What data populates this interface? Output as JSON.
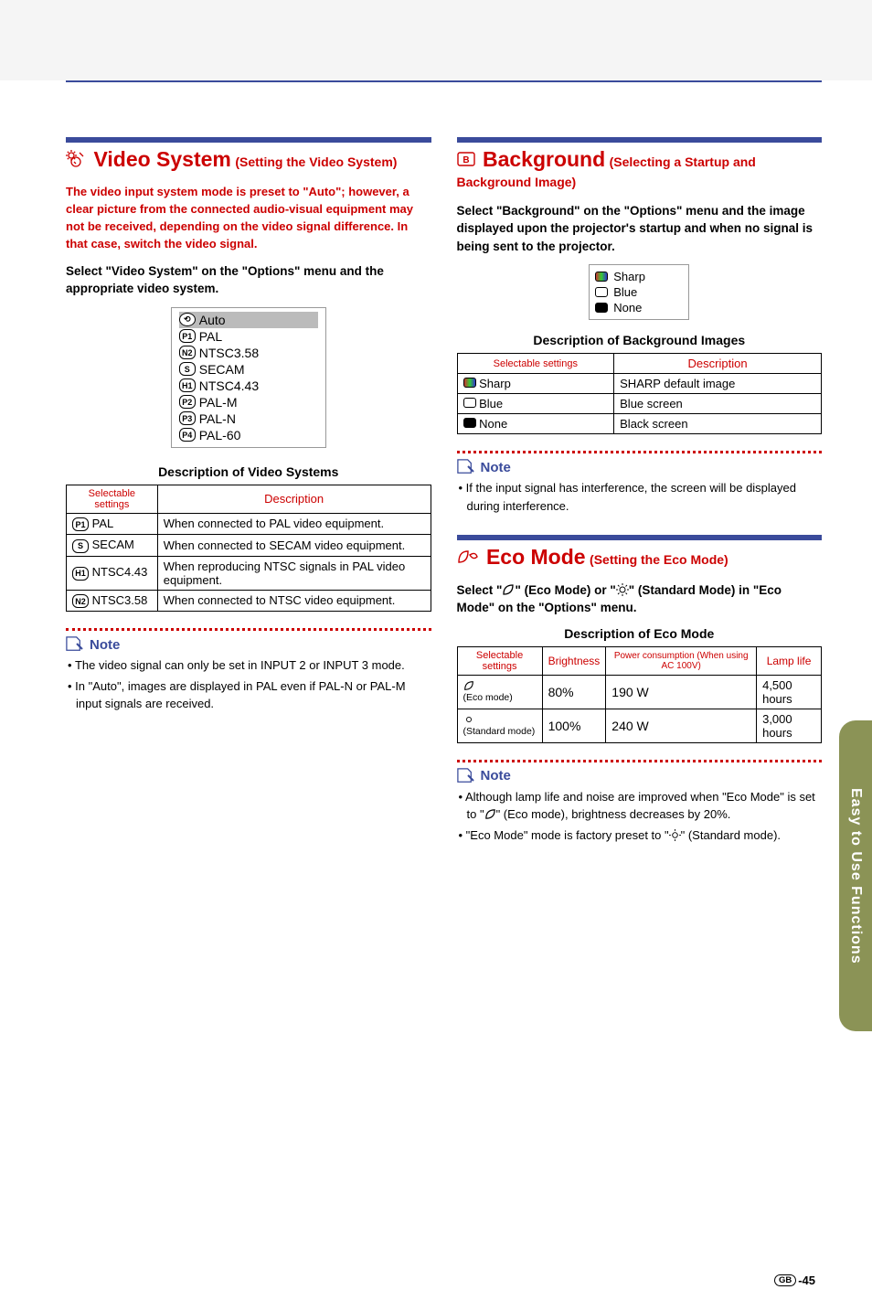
{
  "side_tab": "Easy to Use Functions",
  "left": {
    "title_main": "Video System",
    "title_sub": "(Setting the Video System)",
    "intro": "The video input system mode is preset to \"Auto\"; however, a clear picture from the connected audio-visual equipment may not be received, depending on the video signal difference. In that case, switch the video signal.",
    "instruct": "Select \"Video System\" on the \"Options\" menu and the appropriate video system.",
    "menu_items": [
      "Auto",
      "PAL",
      "NTSC3.58",
      "SECAM",
      "NTSC4.43",
      "PAL-M",
      "PAL-N",
      "PAL-60"
    ],
    "menu_badges": [
      "",
      "P1",
      "N2",
      "S",
      "H1",
      "P2",
      "P3",
      "P4"
    ],
    "desc_title": "Description of Video Systems",
    "table": {
      "head": [
        "Selectable settings",
        "Description"
      ],
      "rows": [
        {
          "b": "P1",
          "s": "PAL",
          "d": "When connected to PAL video equipment."
        },
        {
          "b": "S",
          "s": "SECAM",
          "d": "When connected to SECAM video equipment."
        },
        {
          "b": "H1",
          "s": "NTSC4.43",
          "d": "When reproducing NTSC signals in PAL video equipment."
        },
        {
          "b": "N2",
          "s": "NTSC3.58",
          "d": "When connected to NTSC video equipment."
        }
      ]
    },
    "note_label": "Note",
    "notes": [
      "The video signal can only be set in INPUT 2 or INPUT 3 mode.",
      "In \"Auto\", images are displayed in PAL even if PAL-N or PAL-M input signals are received."
    ]
  },
  "right": {
    "bg_title_main": "Background",
    "bg_title_sub": "(Selecting a Startup and Background Image)",
    "bg_instruct": "Select \"Background\" on the \"Options\" menu and the image displayed upon the projector's startup and when no signal is being sent to the projector.",
    "bg_menu": [
      "Sharp",
      "Blue",
      "None"
    ],
    "bg_desc_title": "Description of Background Images",
    "bg_table": {
      "head": [
        "Selectable settings",
        "Description"
      ],
      "rows": [
        {
          "ic": "sharp",
          "s": "Sharp",
          "d": "SHARP default image"
        },
        {
          "ic": "blue",
          "s": "Blue",
          "d": "Blue screen"
        },
        {
          "ic": "none",
          "s": "None",
          "d": "Black screen"
        }
      ]
    },
    "bg_note_label": "Note",
    "bg_notes": [
      "If the input signal has interference, the screen will be displayed during interference."
    ],
    "eco_title_main": "Eco Mode",
    "eco_title_sub": "(Setting the Eco Mode)",
    "eco_instruct_1": "Select \"",
    "eco_instruct_2": "\" (Eco Mode) or \"",
    "eco_instruct_3": "\" (Standard Mode) in \"Eco Mode\" on the \"Options\" menu.",
    "eco_desc_title": "Description of Eco Mode",
    "eco_table": {
      "head": [
        "Selectable settings",
        "Brightness",
        "Power consumption (When using AC 100V)",
        "Lamp life"
      ],
      "rows": [
        {
          "s": "(Eco mode)",
          "b": "80%",
          "p": "190 W",
          "l": "4,500 hours"
        },
        {
          "s": "(Standard mode)",
          "b": "100%",
          "p": "240 W",
          "l": "3,000 hours"
        }
      ]
    },
    "eco_note_label": "Note",
    "eco_notes_1a": "Although lamp life and noise are improved when \"Eco Mode\" is set to \"",
    "eco_notes_1b": "\" (Eco mode), brightness decreases by 20%.",
    "eco_notes_2a": "\"Eco Mode\" mode is factory preset to \"",
    "eco_notes_2b": "\" (Standard mode)."
  },
  "page_lang": "GB",
  "page_num": "-45"
}
